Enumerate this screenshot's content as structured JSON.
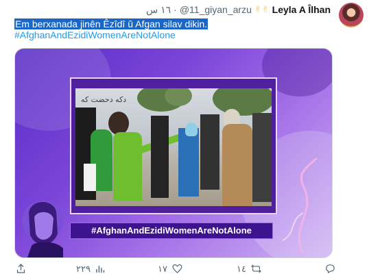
{
  "tweet": {
    "author_name": "Leyla A Îlhan",
    "author_emoji": "✌✌",
    "handle": "@11_giyan_arzu",
    "separator": "·",
    "time": "١٦ س",
    "text_line1": "Em berxanada jinên Êzîdî û Afgan silav dikin.",
    "hashtag": "#AfghanAndEzidiWomenAreNotAlone"
  },
  "media": {
    "banner_text": "دکه دحضت که",
    "strip_text": "#AfghanAndEzidiWomenAreNotAlone"
  },
  "actions": {
    "reply_count": "",
    "retweet_count": "١٤",
    "like_count": "١٧",
    "views_count": "٢٢٩",
    "share_count": ""
  },
  "icons": [
    "avatar",
    "reply-icon",
    "retweet-icon",
    "like-icon",
    "views-icon",
    "share-icon"
  ]
}
